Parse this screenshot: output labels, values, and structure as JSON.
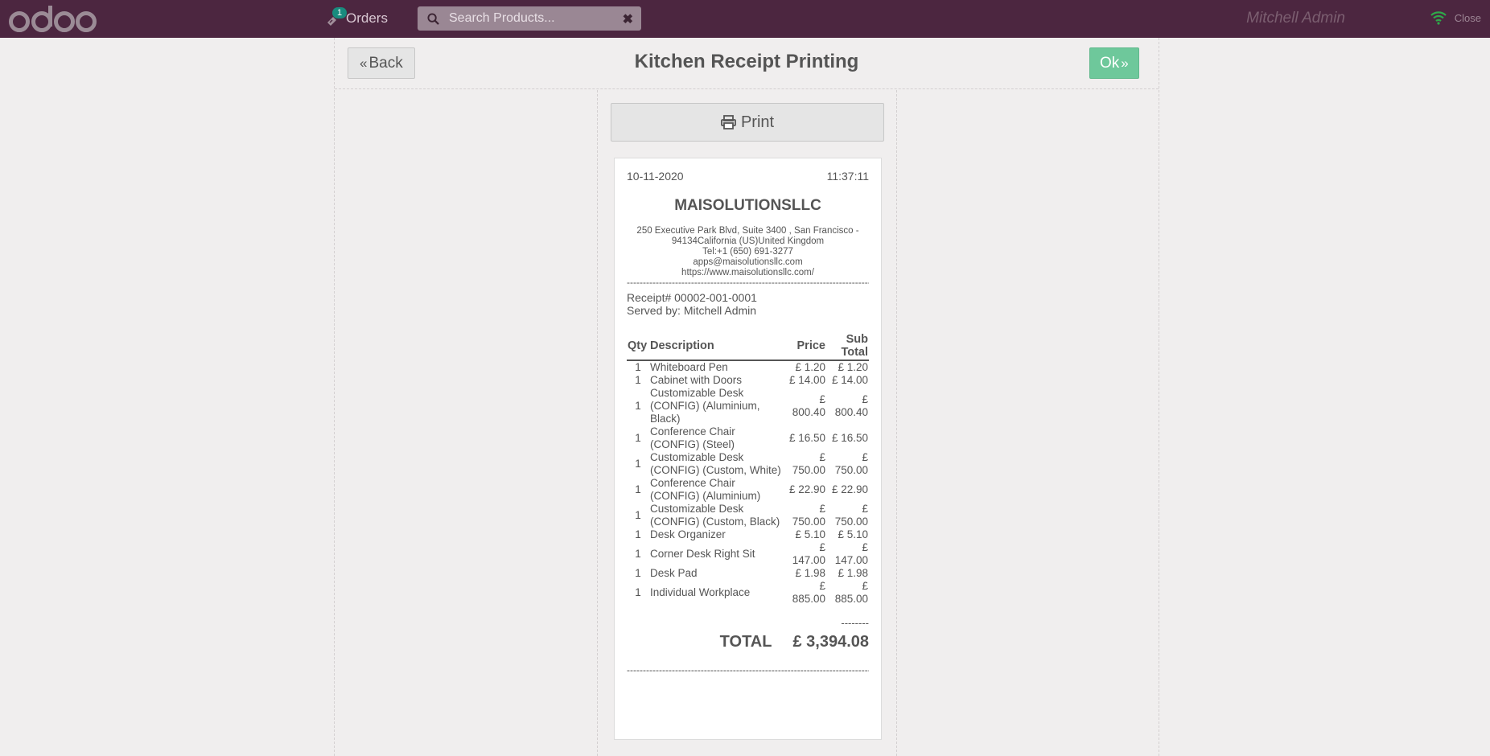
{
  "topbar": {
    "orders_label": "Orders",
    "orders_badge": "1",
    "search_placeholder": "Search Products...",
    "user_name": "Mitchell Admin",
    "close_label": "Close"
  },
  "screen": {
    "title": "Kitchen Receipt Printing",
    "back_label": "Back",
    "ok_label": "Ok",
    "print_label": "Print"
  },
  "receipt": {
    "date": "10-11-2020",
    "time": "11:37:11",
    "company": "MAISOLUTIONSLLC",
    "address_line1": "250 Executive Park Blvd, Suite 3400 , San Francisco -",
    "address_line2": "94134California (US)United Kingdom",
    "phone": "Tel:+1 (650) 691-3277",
    "email": "apps@maisolutionsllc.com",
    "website": "https://www.maisolutionsllc.com/",
    "receipt_no": "Receipt# 00002-001-0001",
    "served_by": "Served by: Mitchell Admin",
    "columns": {
      "qty": "Qty",
      "description": "Description",
      "price": "Price",
      "subtotal": "Sub Total"
    },
    "items": [
      {
        "qty": "1",
        "desc": "Whiteboard Pen",
        "price": "£ 1.20",
        "sub": "£ 1.20"
      },
      {
        "qty": "1",
        "desc": "Cabinet with Doors",
        "price": "£ 14.00",
        "sub": "£ 14.00"
      },
      {
        "qty": "1",
        "desc": "Customizable Desk (CONFIG) (Aluminium, Black)",
        "price": "£ 800.40",
        "sub": "£ 800.40"
      },
      {
        "qty": "1",
        "desc": "Conference Chair (CONFIG) (Steel)",
        "price": "£ 16.50",
        "sub": "£ 16.50"
      },
      {
        "qty": "1",
        "desc": "Customizable Desk (CONFIG) (Custom, White)",
        "price": "£ 750.00",
        "sub": "£ 750.00"
      },
      {
        "qty": "1",
        "desc": "Conference Chair (CONFIG) (Aluminium)",
        "price": "£ 22.90",
        "sub": "£ 22.90"
      },
      {
        "qty": "1",
        "desc": "Customizable Desk (CONFIG) (Custom, Black)",
        "price": "£ 750.00",
        "sub": "£ 750.00"
      },
      {
        "qty": "1",
        "desc": "Desk Organizer",
        "price": "£ 5.10",
        "sub": "£ 5.10"
      },
      {
        "qty": "1",
        "desc": "Corner Desk Right Sit",
        "price": "£ 147.00",
        "sub": "£ 147.00"
      },
      {
        "qty": "1",
        "desc": "Desk Pad",
        "price": "£ 1.98",
        "sub": "£ 1.98"
      },
      {
        "qty": "1",
        "desc": "Individual Workplace",
        "price": "£ 885.00",
        "sub": "£ 885.00"
      }
    ],
    "separator": "--------",
    "total_label": "TOTAL",
    "total_value": "£ 3,394.08"
  }
}
